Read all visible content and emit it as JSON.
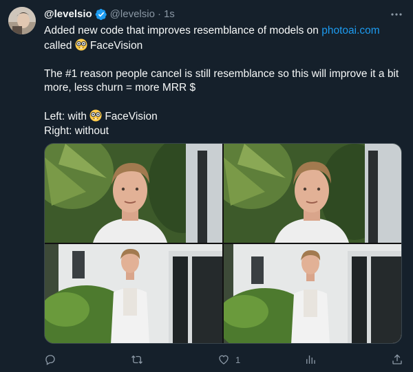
{
  "tweet": {
    "display_name": "@levelsio",
    "handle": "@levelsio",
    "separator": "·",
    "time": "1s",
    "line1_before_link": "Added new code that improves resemblance of models on ",
    "link_text": "photoai.com",
    "line2": "called ",
    "feature_name": "FaceVision",
    "paragraph2": "The #1 reason people cancel is still resemblance so this will improve it a bit more, less churn = more MRR $",
    "left_label": "Left: with ",
    "right_label": "Right: without",
    "emoji_name": "nerd-face-emoji"
  },
  "media": {
    "photos": [
      {
        "name": "portrait-with-facevision"
      },
      {
        "name": "portrait-without-facevision"
      },
      {
        "name": "fullbody-with-facevision"
      },
      {
        "name": "fullbody-without-facevision"
      }
    ]
  },
  "actions": {
    "reply_icon": "reply-icon",
    "retweet_icon": "retweet-icon",
    "like_icon": "heart-icon",
    "like_count": "1",
    "views_icon": "views-icon",
    "share_icon": "share-icon"
  },
  "colors": {
    "background": "#15202b",
    "text": "#f7f9f9",
    "muted": "#8b98a5",
    "link": "#1d9bf0",
    "verified": "#1d9bf0"
  }
}
